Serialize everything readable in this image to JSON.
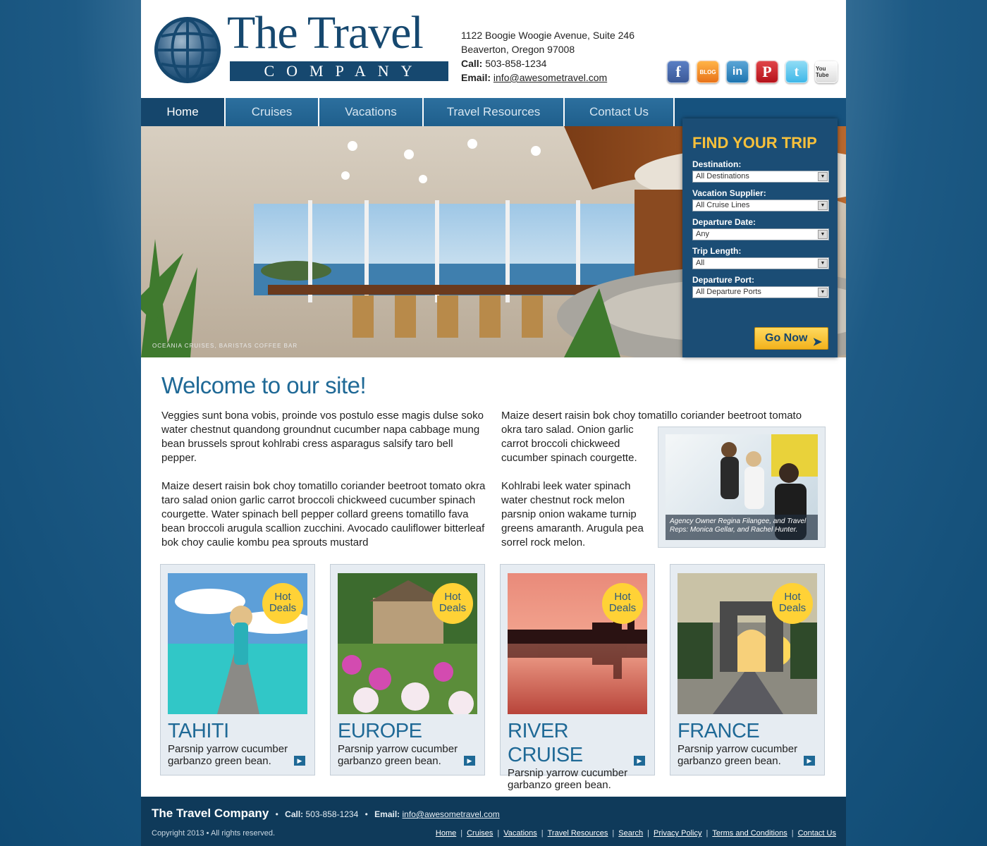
{
  "header": {
    "logo_title": "The Travel",
    "logo_subtitle": "COMPANY",
    "address_line1": "1122 Boogie Woogie Avenue, Suite 246",
    "address_line2": "Beaverton, Oregon  97008",
    "call_label": "Call:",
    "phone": "503-858-1234",
    "email_label": "Email:",
    "email": "info@awesometravel.com",
    "social": [
      {
        "name": "facebook-icon",
        "glyph": "f"
      },
      {
        "name": "blog-icon",
        "glyph": "BLOG"
      },
      {
        "name": "linkedin-icon",
        "glyph": "in"
      },
      {
        "name": "pinterest-icon",
        "glyph": "P"
      },
      {
        "name": "twitter-icon",
        "glyph": "t"
      },
      {
        "name": "youtube-icon",
        "glyph": "You Tube"
      }
    ]
  },
  "nav": {
    "items": [
      "Home",
      "Cruises",
      "Vacations",
      "Travel Resources",
      "Contact Us"
    ],
    "active": "Home"
  },
  "hero": {
    "caption": "OCEANIA CRUISES, BARISTAS COFFEE BAR"
  },
  "trip_finder": {
    "title": "FIND YOUR TRIP",
    "fields": [
      {
        "label": "Destination:",
        "value": "All Destinations"
      },
      {
        "label": "Vacation Supplier:",
        "value": "All Cruise Lines"
      },
      {
        "label": "Departure Date:",
        "value": "Any"
      },
      {
        "label": "Trip Length:",
        "value": "All"
      },
      {
        "label": "Departure Port:",
        "value": "All Departure Ports"
      }
    ],
    "button_label": "Go Now"
  },
  "welcome": {
    "title": "Welcome to our site!",
    "col1_p1": "Veggies sunt bona vobis, proinde vos postulo esse magis dulse soko water chestnut quandong groundnut cucumber napa cabbage mung bean brussels sprout kohlrabi cress asparagus salsify taro bell pepper.",
    "col1_p2": "Maize desert raisin bok choy tomatillo coriander beetroot tomato okra taro salad onion garlic carrot broccoli chickweed cucumber spinach courgette. Water spinach bell pepper collard greens tomatillo fava bean broccoli arugula scallion zucchini. Avocado cauliflower bitterleaf bok choy caulie kombu pea sprouts mustard",
    "col2_line1": "Maize desert raisin bok choy tomatillo coriander beetroot tomato",
    "col2_p1_rest": "okra taro salad. Onion garlic carrot broccoli chickweed cucumber spinach courgette.",
    "col2_p2": "Kohlrabi leek water spinach water chestnut rock melon parsnip onion wakame turnip greens amaranth. Arugula pea sorrel rock melon.",
    "photo_caption": "Agency Owner Regina Filangee, and Travel Reps: Monica Gellar, and Rachel Hunter."
  },
  "deals": [
    {
      "badge_line1": "Hot",
      "badge_line2": "Deals",
      "title": "TAHITI",
      "desc": "Parsnip yarrow cucumber garbanzo green bean."
    },
    {
      "badge_line1": "Hot",
      "badge_line2": "Deals",
      "title": "EUROPE",
      "desc": "Parsnip yarrow cucumber garbanzo green bean."
    },
    {
      "badge_line1": "Hot",
      "badge_line2": "Deals",
      "title": "RIVER CRUISE",
      "desc": "Parsnip yarrow cucumber garbanzo green bean."
    },
    {
      "badge_line1": "Hot",
      "badge_line2": "Deals",
      "title": "FRANCE",
      "desc": "Parsnip yarrow cucumber garbanzo green bean."
    }
  ],
  "footer": {
    "brand": "The Travel Company",
    "call_label": "Call:",
    "phone": "503-858-1234",
    "email_label": "Email:",
    "email": "info@awesometravel.com",
    "copyright": "Copyright 2013",
    "rights": "All rights reserved.",
    "links": [
      "Home",
      "Cruises",
      "Vacations",
      "Travel Resources",
      "Search",
      "Privacy Policy",
      "Terms and Conditions",
      "Contact Us"
    ]
  },
  "colors": {
    "brand_blue": "#16486f",
    "accent_yellow": "#f7c03b",
    "heading_blue": "#1f6996",
    "nav_blue": "#2c6f9e"
  }
}
